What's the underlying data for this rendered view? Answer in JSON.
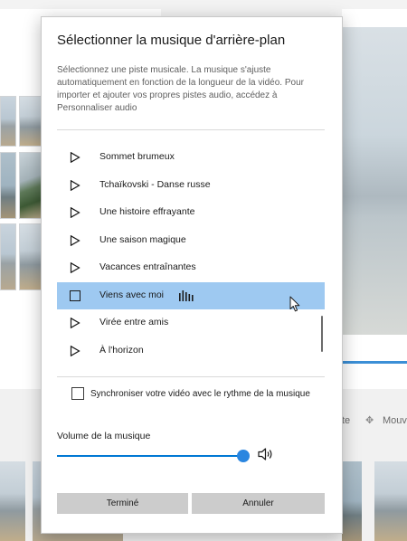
{
  "background": {
    "toolbar_items": [
      "te",
      "Mouve"
    ]
  },
  "dialog": {
    "title": "Sélectionner la musique d'arrière-plan",
    "description": "Sélectionnez une piste musicale. La musique s'ajuste automatiquement en fonction de la longueur de la vidéo. Pour importer et ajouter vos propres pistes audio, accédez à Personnaliser audio",
    "tracks": [
      {
        "name": "Sommet brumeux",
        "selected": false
      },
      {
        "name": "Tchaïkovski - Danse russe",
        "selected": false
      },
      {
        "name": "Une histoire effrayante",
        "selected": false
      },
      {
        "name": "Une saison magique",
        "selected": false
      },
      {
        "name": "Vacances entraînantes",
        "selected": false
      },
      {
        "name": "Viens avec moi",
        "selected": true
      },
      {
        "name": "Virée entre amis",
        "selected": false
      },
      {
        "name": "À l'horizon",
        "selected": false
      }
    ],
    "sync_label": "Synchroniser votre vidéo avec le rythme de la musique",
    "sync_checked": false,
    "volume_label": "Volume de la musique",
    "volume_value": 1.0,
    "done_label": "Terminé",
    "cancel_label": "Annuler",
    "colors": {
      "selected_row": "#9ec9f1",
      "accent": "#0078d4",
      "button": "#cccccc"
    }
  }
}
